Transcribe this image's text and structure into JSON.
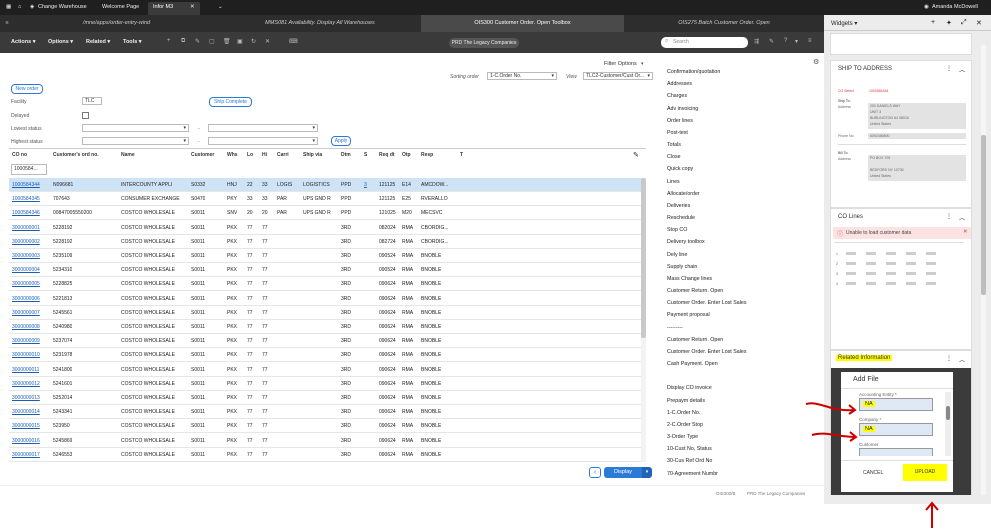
{
  "titlebar": {
    "change_warehouse": "Change Warehouse",
    "welcome_page": "Welcome Page",
    "active_tab": "Infor M3",
    "user": "Amanda McDowell"
  },
  "tabs": [
    {
      "label": "/mne/apps/order-entry-wind",
      "active": false
    },
    {
      "label": "MMS081 Availability. Display All Warehouses",
      "active": false
    },
    {
      "label": "OIS300 Customer Order. Open Toolbox",
      "active": true
    },
    {
      "label": "OIS275 Batch Customer Order. Open",
      "active": false
    }
  ],
  "toolbar": {
    "menus": [
      "Actions",
      "Options",
      "Related",
      "Tools"
    ],
    "company": "PRD The Legacy Companies",
    "search_placeholder": "Search"
  },
  "filter": {
    "filter_options": "Filter Options",
    "sorting_order_label": "Sorting order",
    "sorting_order_value": "1-C.Order No.",
    "view_label": "View",
    "view_value": "TLC2-Customer/Cust Or...",
    "new_order": "New order",
    "facility_label": "Facility",
    "facility_value": "TLC",
    "delayed_label": "Delayed",
    "lowest_status_label": "Lowest status",
    "highest_status_label": "Highest status",
    "dash": "-",
    "ship_complete": "Ship Complete",
    "apply": "Apply"
  },
  "grid": {
    "columns": [
      "CO no",
      "Customer's ord no.",
      "Name",
      "Customer",
      "Whs",
      "Lo",
      "Hi",
      "Carri",
      "Ship via",
      "Dtm",
      "S",
      "Req dt",
      "Otp",
      "Resp",
      "T"
    ],
    "co_filter": "1000584...",
    "rows": [
      [
        "1000584344",
        "N096681",
        "INTERCOUNTY APPLI",
        "S0332",
        "HNJ",
        "22",
        "33",
        "LOGIS",
        "LOGISTICS",
        "PPD",
        "3",
        "121125",
        "E14",
        "AMCDOW..."
      ],
      [
        "1000584345",
        "707643",
        "CONSUMER EXCHANGE",
        "S0470",
        "PKY",
        "33",
        "33",
        "PAR",
        "UPS GND R",
        "PPD",
        "",
        "121125",
        "E25",
        "RVERALLO"
      ],
      [
        "1000584346",
        "00847005550200",
        "COSTCO WHOLESALE",
        "S0011",
        "SNV",
        "20",
        "20",
        "PAR",
        "UPS GND R",
        "PPD",
        "",
        "121025",
        "M20",
        "MECSVC"
      ],
      [
        "3000000001",
        "5228192",
        "COSTCO WHOLESALE",
        "S0011",
        "PKX",
        "77",
        "77",
        "",
        "",
        "3RD",
        "",
        "082024",
        "RMA",
        "CBORDIG..."
      ],
      [
        "3000000002",
        "5228192",
        "COSTCO WHOLESALE",
        "S0011",
        "PKX",
        "77",
        "77",
        "",
        "",
        "3RD",
        "",
        "082724",
        "RMA",
        "CBORDIG..."
      ],
      [
        "3000000003",
        "5235109",
        "COSTCO WHOLESALE",
        "S0011",
        "PKX",
        "77",
        "77",
        "",
        "",
        "3RD",
        "",
        "090524",
        "RMA",
        "BNOBLE"
      ],
      [
        "3000000004",
        "5234310",
        "COSTCO WHOLESALE",
        "S0011",
        "PKX",
        "77",
        "77",
        "",
        "",
        "3RD",
        "",
        "090524",
        "RMA",
        "BNOBLE"
      ],
      [
        "3000000005",
        "5228825",
        "COSTCO WHOLESALE",
        "S0011",
        "PKX",
        "77",
        "77",
        "",
        "",
        "3RD",
        "",
        "090624",
        "RMA",
        "BNOBLE"
      ],
      [
        "3000000006",
        "5221813",
        "COSTCO WHOLESALE",
        "S0011",
        "PKX",
        "77",
        "77",
        "",
        "",
        "3RD",
        "",
        "090624",
        "RMA",
        "BNOBLE"
      ],
      [
        "3000000007",
        "5245561",
        "COSTCO WHOLESALE",
        "S0011",
        "PKX",
        "77",
        "77",
        "",
        "",
        "3RD",
        "",
        "090624",
        "RMA",
        "BNOBLE"
      ],
      [
        "3000000008",
        "5240980",
        "COSTCO WHOLESALE",
        "S0011",
        "PKX",
        "77",
        "77",
        "",
        "",
        "3RD",
        "",
        "090624",
        "RMA",
        "BNOBLE"
      ],
      [
        "3000000009",
        "5237074",
        "COSTCO WHOLESALE",
        "S0011",
        "PKX",
        "77",
        "77",
        "",
        "",
        "3RD",
        "",
        "090624",
        "RMA",
        "BNOBLE"
      ],
      [
        "3000000010",
        "5231978",
        "COSTCO WHOLESALE",
        "S0011",
        "PKX",
        "77",
        "77",
        "",
        "",
        "3RD",
        "",
        "090624",
        "RMA",
        "BNOBLE"
      ],
      [
        "3000000011",
        "5241800",
        "COSTCO WHOLESALE",
        "S0011",
        "PKX",
        "77",
        "77",
        "",
        "",
        "3RD",
        "",
        "090624",
        "RMA",
        "BNOBLE"
      ],
      [
        "3000000012",
        "5241601",
        "COSTCO WHOLESALE",
        "S0011",
        "PKX",
        "77",
        "77",
        "",
        "",
        "3RD",
        "",
        "090624",
        "RMA",
        "BNOBLE"
      ],
      [
        "3000000013",
        "5252014",
        "COSTCO WHOLESALE",
        "S0011",
        "PKX",
        "77",
        "77",
        "",
        "",
        "3RD",
        "",
        "090624",
        "RMA",
        "BNOBLE"
      ],
      [
        "3000000014",
        "5243341",
        "COSTCO WHOLESALE",
        "S0011",
        "PKX",
        "77",
        "77",
        "",
        "",
        "3RD",
        "",
        "090624",
        "RMA",
        "BNOBLE"
      ],
      [
        "3000000015",
        "523950",
        "COSTCO WHOLESALE",
        "S0011",
        "PKX",
        "77",
        "77",
        "",
        "",
        "3RD",
        "",
        "090624",
        "RMA",
        "BNOBLE"
      ],
      [
        "3000000016",
        "5245869",
        "COSTCO WHOLESALE",
        "S0011",
        "PKX",
        "77",
        "77",
        "",
        "",
        "3RD",
        "",
        "090624",
        "RMA",
        "BNOBLE"
      ],
      [
        "3000000017",
        "5246553",
        "COSTCO WHOLESALE",
        "S0011",
        "PKX",
        "77",
        "77",
        "",
        "",
        "3RD",
        "",
        "090624",
        "RMA",
        "BNOBLE"
      ]
    ],
    "display_button": "Display"
  },
  "related_options": [
    "Confirmation/quotation",
    "Addresses",
    "Charges",
    "Adv invoicing",
    "Order lines",
    "Post-text",
    "Totals",
    "Close",
    "Quick copy",
    "Lines",
    "Allocate/order",
    "Deliveries",
    "Reschedule",
    "Stop CO",
    "Delivery toolbox",
    "Dely line",
    "Supply chain",
    "Mass Change lines",
    "Customer Return. Open",
    "Customer Order. Enter Lost Sales",
    "Payment proposal",
    "---------",
    "Customer Return. Open",
    "Customer Order. Enter Lost Sales",
    "Cash Payment. Open",
    "",
    "Display CO invoice",
    "Prepaym details",
    "1-C.Order No.",
    "2-C.Order Stop",
    "3-Order Type",
    "10-Cust No, Status",
    "30-Cus Ref Ord No",
    "70-Agreement Numbr"
  ],
  "footer": {
    "program": "OIS300/B",
    "company": "PRD The Legacy Companies"
  },
  "widgets": {
    "title": "Widgets",
    "ship_to": {
      "title": "SHIP TO ADDRESS",
      "co_select_label": "CO Select",
      "co_select_value": "1000584344",
      "ship_to_label": "Ship To:",
      "address_label": "Address",
      "address_lines": [
        "200 DANIELS WAY",
        "UNIT 3",
        "BURLINGTON NJ 08016",
        "United States"
      ],
      "phone_label": "Phone No",
      "phone_value": "6092456800",
      "bill_to_label": "Bill To:",
      "bill_address_label": "Address",
      "bill_lines": [
        "PO BOX 709",
        "",
        "BEDFORD NY 10730",
        "United States"
      ]
    },
    "co_lines": {
      "title": "CO Lines",
      "error": "Unable to load customer data",
      "rows": [
        "1",
        "2",
        "3",
        "4"
      ]
    },
    "related": {
      "title": "Related Information",
      "dialog_title": "Add File",
      "accounting_entity_label": "Accounting Entity *",
      "accounting_entity_value": "NA",
      "company_label": "Company *",
      "company_value": "NA",
      "customer_label": "Customer",
      "cancel": "CANCEL",
      "upload": "UPLOAD"
    }
  },
  "colors": {
    "accent": "#2b7bd6",
    "highlight": "#ffff00",
    "annotation": "#cc0000",
    "error": "#d9363e"
  }
}
